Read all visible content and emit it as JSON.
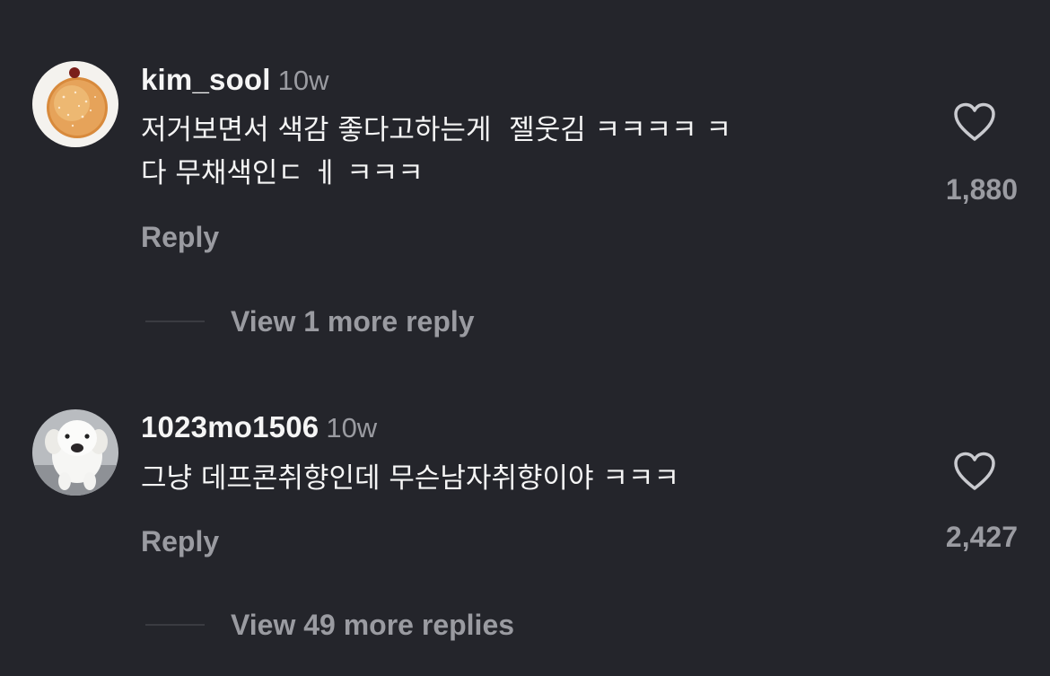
{
  "comments": [
    {
      "avatar": "donut-avatar",
      "username": "kim_sool",
      "time": "10w",
      "text": "저거보면서 색감 좋다고하는게  젤웃김 ㅋㅋㅋㅋ ㅋ\n다 무채색인ㄷ ㅔ ㅋㅋㅋ",
      "reply_label": "Reply",
      "likes": "1,880",
      "heart_icon": "heart-outline-icon",
      "view_more": "View 1 more reply"
    },
    {
      "avatar": "puppy-avatar",
      "username": "1023mo1506",
      "time": "10w",
      "text": "그냥 데프콘취향인데 무슨남자취향이야 ㅋㅋㅋ",
      "reply_label": "Reply",
      "likes": "2,427",
      "heart_icon": "heart-outline-icon",
      "view_more": "View 49 more replies"
    }
  ]
}
